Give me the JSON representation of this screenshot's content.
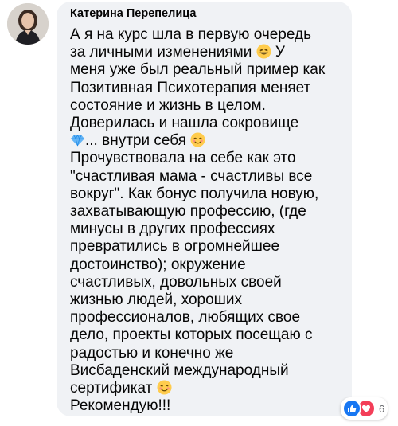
{
  "comment": {
    "author": "Катерина Перепелица",
    "lines": [
      "А я на курс шла в первую очередь",
      "за личными изменениями",
      "У",
      "меня уже был реальный пример как",
      "Позитивная Психотерапия меняет",
      "состояние и жизнь в целом.",
      "Доверилась и нашла сокровище",
      "... внутри себя",
      "Прочувствовала на себе как это",
      "\"счастливая мама - счастливы все",
      "вокруг\". Как бонус получила новую,",
      "захватывающую профессию, (где",
      "минусы в других профессиях",
      "превратились в огромнейшее",
      "достоинство); окружение",
      "счастливых, довольных своей",
      "жизнью людей, хороших",
      "профессионалов, любящих свое",
      "дело, проекты которых посещаю с",
      "радостью и конечно же",
      "Висбаденский международный",
      "сертификат",
      "Рекомендую!!!"
    ],
    "emojis": [
      "grinning-squint-emoji",
      "gem-emoji",
      "smiling-face-emoji",
      "smiling-face-emoji"
    ]
  },
  "reactions": {
    "count": "6",
    "types": [
      "like",
      "love"
    ],
    "colors": {
      "like": "#1877f2",
      "love": "#f33e58"
    }
  },
  "colors": {
    "bubble": "#f0f2f5",
    "text": "#050505",
    "muted": "#65676b"
  }
}
